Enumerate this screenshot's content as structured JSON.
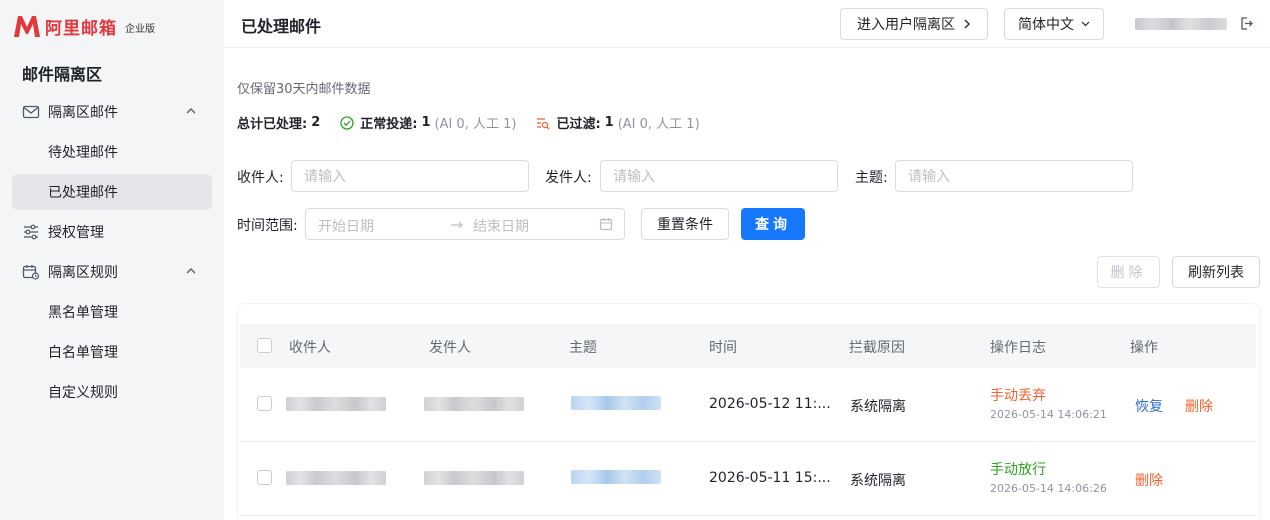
{
  "brand": {
    "name": "阿里邮箱",
    "edition": "企业版",
    "color": "#e0393e"
  },
  "sidebar": {
    "title": "邮件隔离区",
    "items": [
      {
        "label": "隔离区邮件",
        "icon": "mail-icon",
        "expanded": true
      },
      {
        "label": "待处理邮件"
      },
      {
        "label": "已处理邮件",
        "active": true
      },
      {
        "label": "授权管理",
        "icon": "sliders-icon"
      },
      {
        "label": "隔离区规则",
        "icon": "calendar-rule-icon",
        "expanded": true
      },
      {
        "label": "黑名单管理"
      },
      {
        "label": "白名单管理"
      },
      {
        "label": "自定义规则"
      }
    ]
  },
  "header": {
    "title": "已处理邮件",
    "enter_user_quarantine": "进入用户隔离区",
    "language": "简体中文"
  },
  "info": {
    "retention": "仅保留30天内邮件数据",
    "total_label": "总计已处理:",
    "total_value": "2",
    "delivered_label": "正常投递:",
    "delivered_value": "1",
    "delivered_detail": "(AI 0, 人工 1)",
    "filtered_label": "已过滤:",
    "filtered_value": "1",
    "filtered_detail": "(AI 0, 人工 1)"
  },
  "filters": {
    "recipient_label": "收件人:",
    "recipient_placeholder": "请输入",
    "sender_label": "发件人:",
    "sender_placeholder": "请输入",
    "subject_label": "主题:",
    "subject_placeholder": "请输入",
    "time_label": "时间范围:",
    "start_placeholder": "开始日期",
    "end_placeholder": "结束日期",
    "reset": "重置条件",
    "query": "查询"
  },
  "toolbar": {
    "delete": "删除",
    "refresh": "刷新列表"
  },
  "table": {
    "columns": [
      "收件人",
      "发件人",
      "主题",
      "时间",
      "拦截原因",
      "操作日志",
      "操作"
    ],
    "rows": [
      {
        "time": "2026-05-12 11:...",
        "reason": "系统隔离",
        "log_action": "手动丢弃",
        "log_time": "2026-05-14 14:06:21",
        "ops": [
          "恢复",
          "删除"
        ]
      },
      {
        "time": "2026-05-11 15:...",
        "reason": "系统隔离",
        "log_action": "手动放行",
        "log_time": "2026-05-14 14:06:26",
        "ops": [
          "删除"
        ]
      }
    ]
  },
  "colors": {
    "primary": "#1677ff",
    "danger": "#f5622d",
    "success": "#2ea121",
    "link": "#3370c9"
  }
}
